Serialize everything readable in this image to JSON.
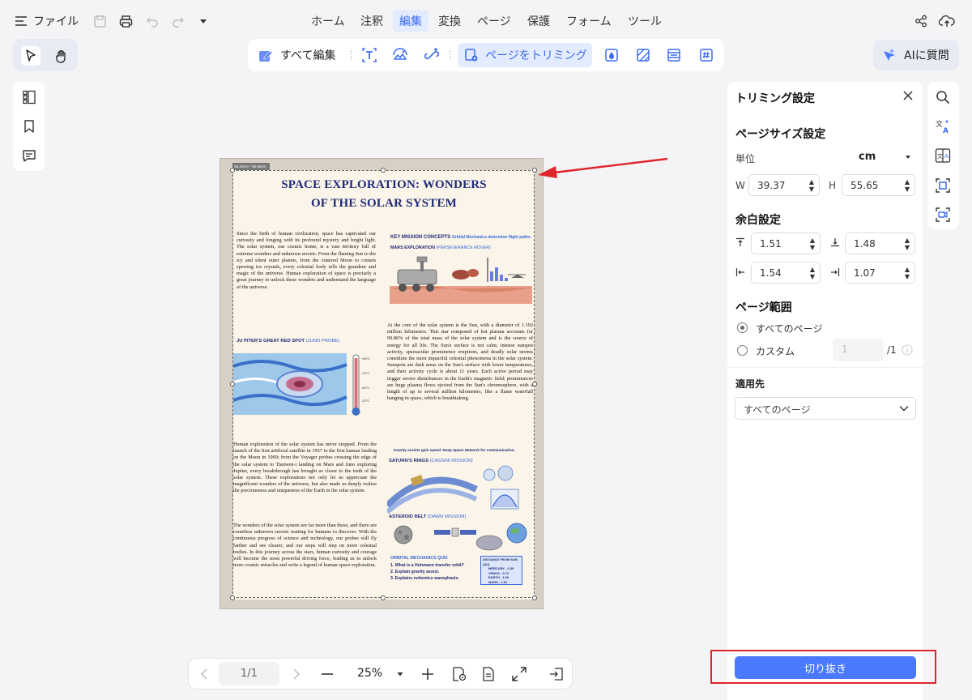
{
  "menubar": {
    "file_label": "ファイル",
    "tabs": [
      "ホーム",
      "注釈",
      "編集",
      "変換",
      "ページ",
      "保護",
      "フォーム",
      "ツール"
    ],
    "active_tab": "編集"
  },
  "toolbar": {
    "edit_all_label": "すべて編集",
    "trim_page_label": "ページをトリミング",
    "ai_label": "AIに質問"
  },
  "document": {
    "size_tag": "39.40cm * 55.65cm",
    "title_line1": "SPACE EXPLORATION: WONDERS",
    "title_line2": "OF THE SOLAR SYSTEM",
    "para1": "Since the birth of human civilization, space has captivated our curiosity and longing with its profound mystery and bright light. The solar system, our cosmic home, is a vast territory full of extreme wonders and unknown secrets. From the flaming Sun to the icy and silent outer planets, from the cratered Moon to comets spewing ice crystals, every celestial body tells the grandeur and magic of the universe. Human exploration of space is precisely a great journey to unlock these wonders and understand the language of the universe.",
    "key_mission": "KEY MISSION CONCEPTS",
    "key_mission_sub": "Orbital Mechanics determine flight paths.",
    "mars_title": "MARS EXPLORATION",
    "mars_probe": "(PERSEVERANCE ROVER)",
    "para2": "At the core of the solar system is the Sun, with a diameter of 1.392 million kilometers. This star composed of hot plasma accounts for 99.86% of the total mass of the solar system and is the source of energy for all life. The Sun's surface is not calm; intense sunspot activity, spectacular prominence eruptions, and deadly solar storms constitute the most impactful celestial phenomena in the solar system. Sunspots are dark areas on the Sun's surface with lower temperatures, and their activity cycle is about 11 years. Each active period may trigger severe disturbances in the Earth's magnetic field; prominences are huge plasma flows ejected from the Sun's chromosphere, with a length of up to several million kilometers, like a flame waterfall hanging in space, which is breathtaking.",
    "jupiter_title": "JU PITER'S GREAT RED SPOT",
    "jupiter_probe": "(JUNO PROBE)",
    "para3": "Human exploration of the solar system has never stopped. From the launch of the first artificial satellite in 1957 to the first human landing on the Moon in 1969; from the Voyager probes crossing the edge of the solar system to Tianwen-i landing on Mars and Juno exploring Jupiter, every breakthrough has brought us closer to the truth of the solar system. These explorations not only let us appreciate the magnificent wonders of the universe, but also made us deeply realize the preciousness and uniqueness of the Earth in the solar system.",
    "para4": "The wonders of the solar system are far more than these, and there are countless unknown secrets waiting for humans to discover. With the continuous progress of science and technology, our probes will fly farther and see clearer, and our steps will step on more celestial bodies. In this journey across the stars, human curiosity and courage will become the most powerful driving force, leading us to unlock more cosmic miracles and write a legend of human space exploration.",
    "gravity_note": "Gravity assists gain speed. Deep Space Network for communication.",
    "saturn_title": "SATURN'S RINGS",
    "saturn_probe": "(CASSINI MISSION)",
    "asteroid_title": "ASTEROID BELT",
    "asteroid_probe": "(DAWN MISSION)",
    "quiz_title": "ORBITAL MECHANICS QUIZ",
    "quiz_items": [
      "1. What is a Hohmann transfer orbit?",
      "2. Explain gravity assist.",
      "3. Explains nohemics wavephasis."
    ],
    "distance_title": "DISTANCE FROM SUN (AU)",
    "distance_rows": [
      "MERCURY - 0.39",
      "VENUS - 0.72",
      "EARTH  - 1.00",
      "MARS  - 1.52"
    ]
  },
  "panel": {
    "title": "トリミング設定",
    "page_size_heading": "ページサイズ設定",
    "unit_label": "単位",
    "unit_value": "cm",
    "w_label": "W",
    "w_value": "39.37",
    "h_label": "H",
    "h_value": "55.65",
    "margin_heading": "余白設定",
    "margin_top": "1.51",
    "margin_bottom": "1.48",
    "margin_left": "1.54",
    "margin_right": "1.07",
    "range_heading": "ページ範囲",
    "range_all": "すべてのページ",
    "range_custom": "カスタム",
    "custom_value": "1",
    "custom_total": "/1",
    "apply_heading": "適用先",
    "apply_value": "すべてのページ",
    "crop_button": "切り抜き"
  },
  "bottombar": {
    "page_indicator": "1/1",
    "zoom": "25%"
  },
  "colors": {
    "accent": "#3d6cf0",
    "crop_button": "#4a78ff",
    "annotation_red": "#e0242b"
  }
}
